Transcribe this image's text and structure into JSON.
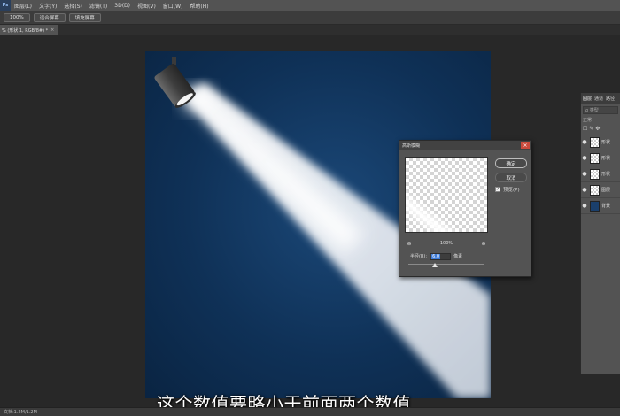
{
  "menubar": {
    "logo": "Ps",
    "items": [
      "图层(L)",
      "文字(Y)",
      "选择(S)",
      "滤镜(T)",
      "3D(D)",
      "视图(V)",
      "窗口(W)",
      "帮助(H)"
    ]
  },
  "options": {
    "buttons": [
      "100%",
      "适合屏幕",
      "填充屏幕"
    ]
  },
  "tab": {
    "label": "% (形状 1, RGB/8#) *",
    "close": "×"
  },
  "subtitle": "这个数值要略小于前面两个数值",
  "statusbar": {
    "text": "文档:1.2M/1.2M"
  },
  "layers": {
    "tabs": [
      "图层",
      "通道",
      "路径"
    ],
    "search_placeholder": "ρ 类型",
    "mode": "正常",
    "lock_icons": "☐ ✎ ✥",
    "rows": [
      {
        "name": "形状",
        "visible": true
      },
      {
        "name": "形状",
        "visible": true
      },
      {
        "name": "形状",
        "visible": true
      },
      {
        "name": "图层",
        "visible": true
      },
      {
        "name": "背景",
        "visible": true
      }
    ]
  },
  "dialog": {
    "title": "高斯模糊",
    "close": "×",
    "ok_label": "确定",
    "cancel_label": "取消",
    "preview_label": "预览(P)",
    "preview_checked": true,
    "zoom_out": "⊖",
    "zoom_level": "100%",
    "zoom_in": "⊕",
    "radius_label": "半径(R):",
    "radius_value": "6.0",
    "radius_unit": "像素",
    "slider_fraction": 0.35
  },
  "colors": {
    "canvas_bg": "#0f3157",
    "panel_bg": "#535353",
    "close_red": "#c84a3c",
    "selection_blue": "#3d7ad6"
  }
}
